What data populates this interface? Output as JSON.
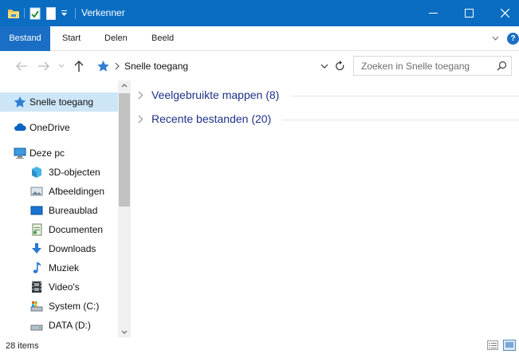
{
  "window": {
    "title": "Verkenner",
    "accent_color": "#0a6dc2"
  },
  "ribbon": {
    "tabs": [
      {
        "label": "Bestand",
        "active": true
      },
      {
        "label": "Start"
      },
      {
        "label": "Delen"
      },
      {
        "label": "Beeld"
      }
    ],
    "help_label": "?"
  },
  "address": {
    "path": "Snelle toegang",
    "search_placeholder": "Zoeken in Snelle toegang"
  },
  "sidebar": {
    "items": [
      {
        "label": "Snelle toegang",
        "icon": "star-icon",
        "selected": true
      },
      {
        "label": "OneDrive",
        "icon": "cloud-icon"
      },
      {
        "label": "Deze pc",
        "icon": "computer-icon"
      },
      {
        "label": "3D-objecten",
        "icon": "cube-icon"
      },
      {
        "label": "Afbeeldingen",
        "icon": "pictures-icon"
      },
      {
        "label": "Bureaublad",
        "icon": "desktop-icon"
      },
      {
        "label": "Documenten",
        "icon": "documents-icon"
      },
      {
        "label": "Downloads",
        "icon": "download-arrow-icon"
      },
      {
        "label": "Muziek",
        "icon": "music-note-icon"
      },
      {
        "label": "Video's",
        "icon": "film-icon"
      },
      {
        "label": "System (C:)",
        "icon": "system-drive-icon"
      },
      {
        "label": "DATA (D:)",
        "icon": "drive-icon"
      }
    ]
  },
  "main": {
    "groups": [
      {
        "label": "Veelgebruikte mappen (8)",
        "expanded": false
      },
      {
        "label": "Recente bestanden (20)",
        "expanded": false
      }
    ]
  },
  "status": {
    "item_count": "28 items"
  }
}
